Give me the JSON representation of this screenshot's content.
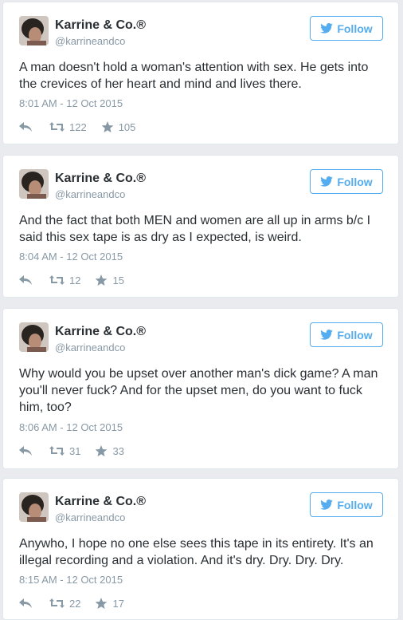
{
  "follow_label": "Follow",
  "accent": "#55acee",
  "tweets": [
    {
      "name": "Karrine & Co.®",
      "handle": "@karrineandco",
      "text": "A man doesn't hold a woman's attention with sex. He gets into the crevices of her heart and mind and lives there.",
      "time": "8:01 AM - 12 Oct 2015",
      "retweets": "122",
      "favorites": "105"
    },
    {
      "name": "Karrine & Co.®",
      "handle": "@karrineandco",
      "text": "And the fact that both MEN and women are all up in arms b/c I said this sex tape is as dry as I expected, is weird.",
      "time": "8:04 AM - 12 Oct 2015",
      "retweets": "12",
      "favorites": "15"
    },
    {
      "name": "Karrine & Co.®",
      "handle": "@karrineandco",
      "text": "Why would you be upset over another man's dick game? A man you'll never fuck? And for the upset men, do you want to fuck him, too?",
      "time": "8:06 AM - 12 Oct 2015",
      "retweets": "31",
      "favorites": "33"
    },
    {
      "name": "Karrine & Co.®",
      "handle": "@karrineandco",
      "text": "Anywho, I hope no one else sees this tape in its entirety. It's an illegal recording and a violation. And it's dry. Dry. Dry. Dry.",
      "time": "8:15 AM - 12 Oct 2015",
      "retweets": "22",
      "favorites": "17"
    }
  ]
}
